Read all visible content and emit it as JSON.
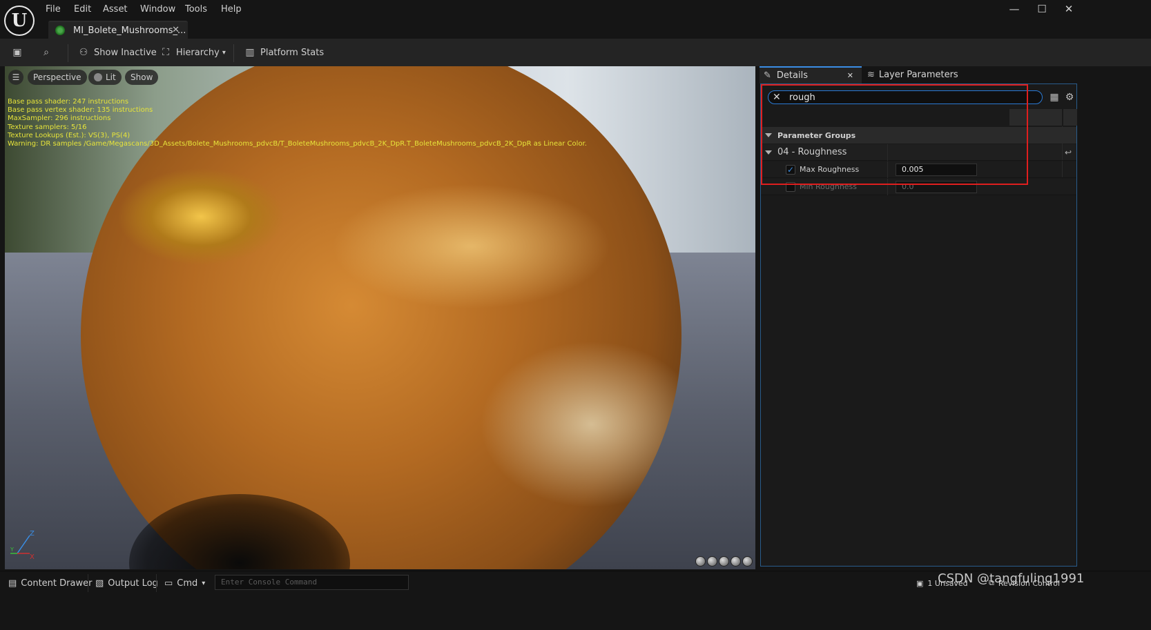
{
  "app": {
    "logo_text": "U",
    "menu": [
      "File",
      "Edit",
      "Asset",
      "Window",
      "Tools",
      "Help"
    ],
    "document_tab": "MI_Bolete_Mushrooms_...",
    "window_controls": {
      "minimize": "—",
      "maximize": "☐",
      "close": "✕"
    }
  },
  "toolbar": {
    "save_icon": "save-icon",
    "browse_icon": "browse-icon",
    "show_inactive": "Show Inactive",
    "hierarchy": "Hierarchy",
    "platform_stats": "Platform Stats"
  },
  "viewport": {
    "perspective": "Perspective",
    "lit": "Lit",
    "show": "Show",
    "stats": [
      "Base pass shader: 247 instructions",
      "Base pass vertex shader: 135 instructions",
      "MaxSampler: 296 instructions",
      "Texture samplers: 5/16",
      "Texture Lookups (Est.): VS(3), PS(4)",
      "Warning: DR samples /Game/Megascans/3D_Assets/Bolete_Mushrooms_pdvcB/T_BoleteMushrooms_pdvcB_2K_DpR.T_BoleteMushrooms_pdvcB_2K_DpR as Linear Color."
    ],
    "axis": {
      "z": "Z",
      "y": "Y",
      "x": "X"
    }
  },
  "details": {
    "tab_details": "Details",
    "tab_details_close": "✕",
    "tab_layer_params": "Layer Parameters",
    "search_value": "rough",
    "group_header": "Parameter Groups",
    "group_name": "04 - Roughness",
    "params": [
      {
        "label": "Max Roughness",
        "value": "0.005",
        "enabled": true
      },
      {
        "label": "Min Roughness",
        "value": "0.0",
        "enabled": false
      }
    ]
  },
  "bottombar": {
    "content_drawer": "Content Drawer",
    "output_log": "Output Log",
    "cmd": "Cmd",
    "console_placeholder": "Enter Console Command",
    "unsaved": "1 Unsaved",
    "revision_control": "Revision Control"
  },
  "watermark": "CSDN @tangfuling1991",
  "colors": {
    "accent": "#3a8ee6",
    "highlight_box": "#e01e1e",
    "stats_text": "#e7e43a"
  }
}
